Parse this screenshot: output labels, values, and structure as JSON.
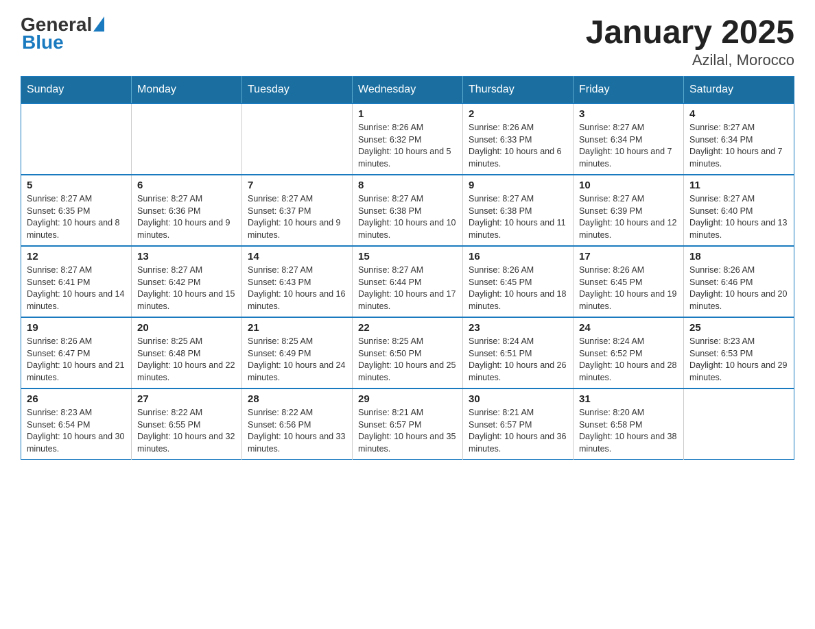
{
  "header": {
    "logo_general": "General",
    "logo_blue": "Blue",
    "title": "January 2025",
    "subtitle": "Azilal, Morocco"
  },
  "weekdays": [
    "Sunday",
    "Monday",
    "Tuesday",
    "Wednesday",
    "Thursday",
    "Friday",
    "Saturday"
  ],
  "weeks": [
    [
      {
        "day": "",
        "info": ""
      },
      {
        "day": "",
        "info": ""
      },
      {
        "day": "",
        "info": ""
      },
      {
        "day": "1",
        "info": "Sunrise: 8:26 AM\nSunset: 6:32 PM\nDaylight: 10 hours and 5 minutes."
      },
      {
        "day": "2",
        "info": "Sunrise: 8:26 AM\nSunset: 6:33 PM\nDaylight: 10 hours and 6 minutes."
      },
      {
        "day": "3",
        "info": "Sunrise: 8:27 AM\nSunset: 6:34 PM\nDaylight: 10 hours and 7 minutes."
      },
      {
        "day": "4",
        "info": "Sunrise: 8:27 AM\nSunset: 6:34 PM\nDaylight: 10 hours and 7 minutes."
      }
    ],
    [
      {
        "day": "5",
        "info": "Sunrise: 8:27 AM\nSunset: 6:35 PM\nDaylight: 10 hours and 8 minutes."
      },
      {
        "day": "6",
        "info": "Sunrise: 8:27 AM\nSunset: 6:36 PM\nDaylight: 10 hours and 9 minutes."
      },
      {
        "day": "7",
        "info": "Sunrise: 8:27 AM\nSunset: 6:37 PM\nDaylight: 10 hours and 9 minutes."
      },
      {
        "day": "8",
        "info": "Sunrise: 8:27 AM\nSunset: 6:38 PM\nDaylight: 10 hours and 10 minutes."
      },
      {
        "day": "9",
        "info": "Sunrise: 8:27 AM\nSunset: 6:38 PM\nDaylight: 10 hours and 11 minutes."
      },
      {
        "day": "10",
        "info": "Sunrise: 8:27 AM\nSunset: 6:39 PM\nDaylight: 10 hours and 12 minutes."
      },
      {
        "day": "11",
        "info": "Sunrise: 8:27 AM\nSunset: 6:40 PM\nDaylight: 10 hours and 13 minutes."
      }
    ],
    [
      {
        "day": "12",
        "info": "Sunrise: 8:27 AM\nSunset: 6:41 PM\nDaylight: 10 hours and 14 minutes."
      },
      {
        "day": "13",
        "info": "Sunrise: 8:27 AM\nSunset: 6:42 PM\nDaylight: 10 hours and 15 minutes."
      },
      {
        "day": "14",
        "info": "Sunrise: 8:27 AM\nSunset: 6:43 PM\nDaylight: 10 hours and 16 minutes."
      },
      {
        "day": "15",
        "info": "Sunrise: 8:27 AM\nSunset: 6:44 PM\nDaylight: 10 hours and 17 minutes."
      },
      {
        "day": "16",
        "info": "Sunrise: 8:26 AM\nSunset: 6:45 PM\nDaylight: 10 hours and 18 minutes."
      },
      {
        "day": "17",
        "info": "Sunrise: 8:26 AM\nSunset: 6:45 PM\nDaylight: 10 hours and 19 minutes."
      },
      {
        "day": "18",
        "info": "Sunrise: 8:26 AM\nSunset: 6:46 PM\nDaylight: 10 hours and 20 minutes."
      }
    ],
    [
      {
        "day": "19",
        "info": "Sunrise: 8:26 AM\nSunset: 6:47 PM\nDaylight: 10 hours and 21 minutes."
      },
      {
        "day": "20",
        "info": "Sunrise: 8:25 AM\nSunset: 6:48 PM\nDaylight: 10 hours and 22 minutes."
      },
      {
        "day": "21",
        "info": "Sunrise: 8:25 AM\nSunset: 6:49 PM\nDaylight: 10 hours and 24 minutes."
      },
      {
        "day": "22",
        "info": "Sunrise: 8:25 AM\nSunset: 6:50 PM\nDaylight: 10 hours and 25 minutes."
      },
      {
        "day": "23",
        "info": "Sunrise: 8:24 AM\nSunset: 6:51 PM\nDaylight: 10 hours and 26 minutes."
      },
      {
        "day": "24",
        "info": "Sunrise: 8:24 AM\nSunset: 6:52 PM\nDaylight: 10 hours and 28 minutes."
      },
      {
        "day": "25",
        "info": "Sunrise: 8:23 AM\nSunset: 6:53 PM\nDaylight: 10 hours and 29 minutes."
      }
    ],
    [
      {
        "day": "26",
        "info": "Sunrise: 8:23 AM\nSunset: 6:54 PM\nDaylight: 10 hours and 30 minutes."
      },
      {
        "day": "27",
        "info": "Sunrise: 8:22 AM\nSunset: 6:55 PM\nDaylight: 10 hours and 32 minutes."
      },
      {
        "day": "28",
        "info": "Sunrise: 8:22 AM\nSunset: 6:56 PM\nDaylight: 10 hours and 33 minutes."
      },
      {
        "day": "29",
        "info": "Sunrise: 8:21 AM\nSunset: 6:57 PM\nDaylight: 10 hours and 35 minutes."
      },
      {
        "day": "30",
        "info": "Sunrise: 8:21 AM\nSunset: 6:57 PM\nDaylight: 10 hours and 36 minutes."
      },
      {
        "day": "31",
        "info": "Sunrise: 8:20 AM\nSunset: 6:58 PM\nDaylight: 10 hours and 38 minutes."
      },
      {
        "day": "",
        "info": ""
      }
    ]
  ]
}
